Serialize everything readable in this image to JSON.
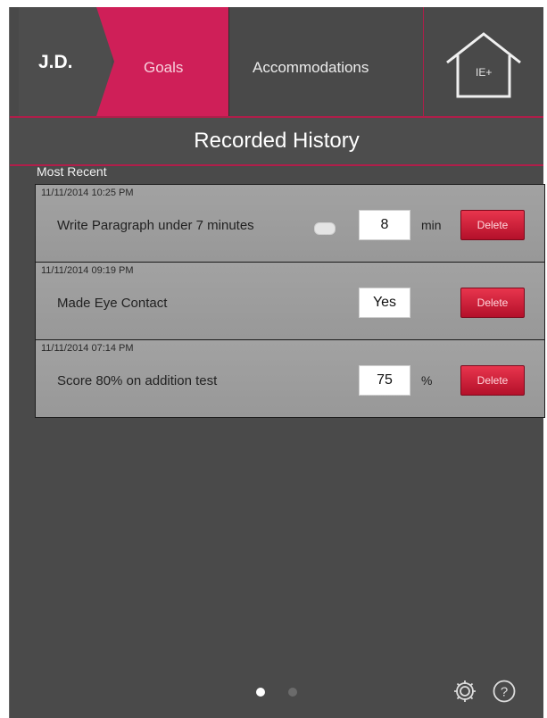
{
  "nav": {
    "initials": "J.D.",
    "goals_label": "Goals",
    "accommodations_label": "Accommodations",
    "home_label": "IE+"
  },
  "header": {
    "title": "Recorded History",
    "section_label": "Most Recent"
  },
  "records": [
    {
      "timestamp": "11/11/2014 10:25 PM",
      "title": "Write Paragraph under 7 minutes",
      "value": "8",
      "unit": "min",
      "delete_label": "Delete",
      "has_toggle": true
    },
    {
      "timestamp": "11/11/2014 09:19 PM",
      "title": "Made Eye Contact",
      "value": "Yes",
      "unit": "",
      "delete_label": "Delete",
      "has_toggle": false
    },
    {
      "timestamp": "11/11/2014 07:14 PM",
      "title": "Score 80% on addition test",
      "value": "75",
      "unit": "%",
      "delete_label": "Delete",
      "has_toggle": false
    }
  ],
  "footer": {
    "page_count": 2,
    "current_page": 1,
    "icons": [
      "settings-icon",
      "help-icon"
    ]
  },
  "colors": {
    "accent": "#cf1f58",
    "delete_red": "#d0223c",
    "background": "#4a4a4a"
  }
}
